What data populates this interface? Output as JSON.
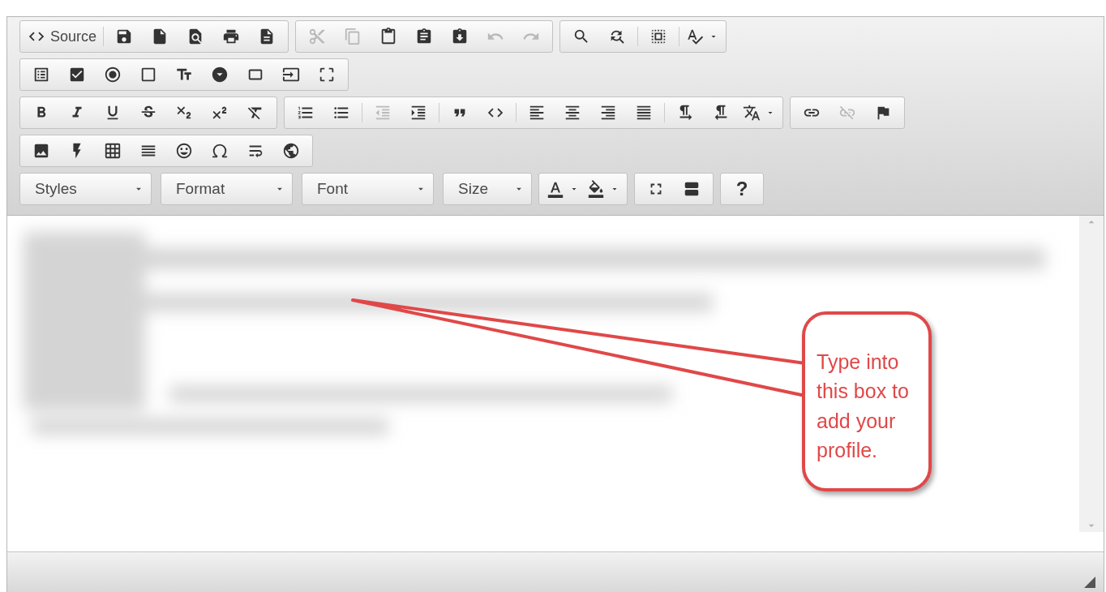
{
  "toolbar": {
    "rows": [
      {
        "groups": [
          {
            "items": [
              {
                "kind": "button",
                "label": "Source",
                "disabled": false
              },
              {
                "kind": "separator"
              },
              {
                "kind": "button",
                "disabled": false
              },
              {
                "kind": "button",
                "disabled": false
              },
              {
                "kind": "button",
                "disabled": false
              },
              {
                "kind": "button",
                "disabled": false
              },
              {
                "kind": "button",
                "disabled": false
              }
            ]
          },
          {
            "items": [
              {
                "kind": "button",
                "disabled": true
              },
              {
                "kind": "button",
                "disabled": true
              },
              {
                "kind": "button",
                "disabled": false
              },
              {
                "kind": "button",
                "disabled": false
              },
              {
                "kind": "button",
                "disabled": false
              },
              {
                "kind": "button",
                "disabled": true
              },
              {
                "kind": "button",
                "disabled": true
              }
            ]
          },
          {
            "items": [
              {
                "kind": "button",
                "disabled": false
              },
              {
                "kind": "button",
                "disabled": false
              },
              {
                "kind": "separator"
              },
              {
                "kind": "button",
                "disabled": false
              },
              {
                "kind": "separator"
              },
              {
                "kind": "menu-button",
                "disabled": false
              }
            ]
          }
        ]
      },
      {
        "groups": [
          {
            "items": [
              {
                "kind": "button",
                "disabled": false
              },
              {
                "kind": "button",
                "disabled": false
              },
              {
                "kind": "button",
                "disabled": false
              },
              {
                "kind": "button",
                "disabled": false
              },
              {
                "kind": "button",
                "disabled": false
              },
              {
                "kind": "button",
                "disabled": false
              },
              {
                "kind": "button",
                "disabled": false
              },
              {
                "kind": "button",
                "disabled": false
              },
              {
                "kind": "button",
                "disabled": false
              }
            ]
          }
        ]
      },
      {
        "groups": [
          {
            "items": [
              {
                "kind": "button",
                "disabled": false
              },
              {
                "kind": "button",
                "disabled": false
              },
              {
                "kind": "button",
                "disabled": false
              },
              {
                "kind": "button",
                "disabled": false
              },
              {
                "kind": "button",
                "disabled": false
              },
              {
                "kind": "button",
                "disabled": false
              },
              {
                "kind": "button",
                "disabled": false
              }
            ]
          },
          {
            "items": [
              {
                "kind": "button",
                "disabled": false
              },
              {
                "kind": "button",
                "disabled": false
              },
              {
                "kind": "separator"
              },
              {
                "kind": "button",
                "disabled": true
              },
              {
                "kind": "button",
                "disabled": false
              },
              {
                "kind": "separator"
              },
              {
                "kind": "button",
                "disabled": false
              },
              {
                "kind": "button",
                "disabled": false
              },
              {
                "kind": "separator"
              },
              {
                "kind": "button",
                "disabled": false
              },
              {
                "kind": "button",
                "disabled": false
              },
              {
                "kind": "button",
                "disabled": false
              },
              {
                "kind": "button",
                "disabled": false
              },
              {
                "kind": "separator"
              },
              {
                "kind": "button",
                "disabled": false
              },
              {
                "kind": "button",
                "disabled": false
              },
              {
                "kind": "menu-button",
                "disabled": false
              }
            ]
          },
          {
            "items": [
              {
                "kind": "button",
                "disabled": false
              },
              {
                "kind": "button",
                "disabled": true
              },
              {
                "kind": "button",
                "disabled": false
              }
            ]
          }
        ]
      },
      {
        "groups": [
          {
            "items": [
              {
                "kind": "button",
                "disabled": false
              },
              {
                "kind": "button",
                "disabled": false
              },
              {
                "kind": "button",
                "disabled": false
              },
              {
                "kind": "button",
                "disabled": false
              },
              {
                "kind": "button",
                "disabled": false
              },
              {
                "kind": "button",
                "disabled": false
              },
              {
                "kind": "button",
                "disabled": false
              },
              {
                "kind": "button",
                "disabled": false
              }
            ]
          }
        ]
      },
      {
        "groups": [
          {
            "kind": "combos",
            "items": [
              {
                "kind": "combo",
                "label": "Styles"
              },
              {
                "kind": "combo",
                "label": "Format"
              },
              {
                "kind": "combo",
                "label": "Font"
              },
              {
                "kind": "combo",
                "label": "Size"
              }
            ]
          },
          {
            "items": [
              {
                "kind": "menu-button",
                "disabled": false
              },
              {
                "kind": "menu-button",
                "disabled": false
              }
            ]
          },
          {
            "items": [
              {
                "kind": "button",
                "disabled": false
              },
              {
                "kind": "button",
                "disabled": false
              }
            ]
          },
          {
            "items": [
              {
                "kind": "text-button",
                "label": "?",
                "disabled": false
              }
            ]
          }
        ]
      }
    ]
  },
  "callout": {
    "text": "Type into this box to add your profile."
  }
}
